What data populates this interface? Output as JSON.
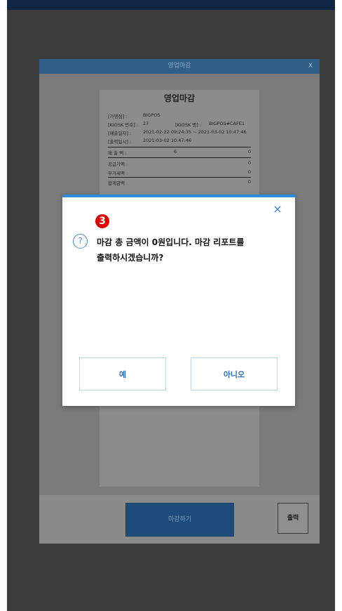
{
  "background_window": {
    "title": "영업마감",
    "close_label": "X",
    "receipt": {
      "title": "영업마감",
      "rows": [
        {
          "label": "[가맹점] :",
          "value": "BIGPOS"
        },
        {
          "label": "[KIOSK 번호] :",
          "value": "27",
          "label2": "[KIOSK 명] :",
          "value2": "BIGPOS#CAFE1"
        },
        {
          "label": "[매출일자] :",
          "value": "2021-02-22 09:24:35 ~ 2021-03-02 10:47:46"
        },
        {
          "label": "[출력일시] :",
          "value": "2021-03-02 10:47:46"
        }
      ],
      "totals": [
        {
          "label": "매 출 액 :",
          "count": "6",
          "amount": "0"
        },
        {
          "label": "공급가액 :",
          "amount": "0"
        },
        {
          "label": "부가세액 :",
          "amount": "0"
        },
        {
          "label": "합계금액 :",
          "amount": "0"
        }
      ]
    },
    "close_shift_button": "마감하기",
    "print_button": "출력"
  },
  "dialog": {
    "step_number": "3",
    "close_icon": "×",
    "question_icon": "?",
    "message": "마감 총 금액이 0원입니다. 마감 리포트를 출력하시겠습니까?",
    "yes_label": "예",
    "no_label": "아니오"
  },
  "colors": {
    "accent": "#2a8be0",
    "step_badge": "#e00000",
    "button_text": "#2d6fb6"
  }
}
